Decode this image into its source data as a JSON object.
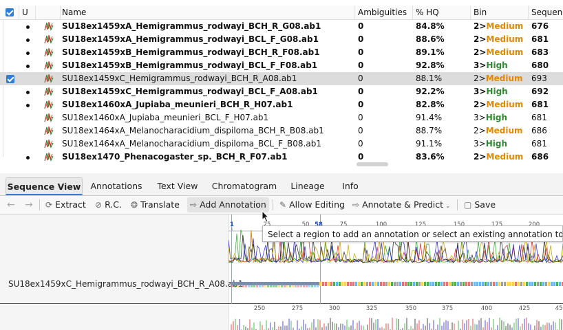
{
  "table": {
    "columns": [
      "",
      "U",
      "",
      "Name",
      "Ambiguities",
      "% HQ",
      "Bin",
      "Sequence"
    ],
    "rows": [
      {
        "name": "SU18ex1459xA_Hemigrammus_rodwayi_BCH_R_G08.ab1",
        "amb": "0",
        "hq": "84.8%",
        "binnum": "2>",
        "binlabel": "Medium",
        "seq": "676",
        "bold": true,
        "checked": false,
        "dot": true
      },
      {
        "name": "SU18ex1459xA_Hemigrammus_rodwayi_BCL_F_G08.ab1",
        "amb": "0",
        "hq": "88.6%",
        "binnum": "2>",
        "binlabel": "Medium",
        "seq": "681",
        "bold": true,
        "checked": false,
        "dot": true
      },
      {
        "name": "SU18ex1459xB_Hemigrammus_rodwayi_BCH_R_F08.ab1",
        "amb": "0",
        "hq": "89.1%",
        "binnum": "2>",
        "binlabel": "Medium",
        "seq": "683",
        "bold": true,
        "checked": false,
        "dot": true
      },
      {
        "name": "SU18ex1459xB_Hemigrammus_rodwayi_BCL_F_F08.ab1",
        "amb": "0",
        "hq": "92.8%",
        "binnum": "3>",
        "binlabel": "High",
        "seq": "680",
        "bold": true,
        "checked": false,
        "dot": true
      },
      {
        "name": "SU18ex1459xC_Hemigrammus_rodwayi_BCH_R_A08.ab1",
        "amb": "0",
        "hq": "88.1%",
        "binnum": "2>",
        "binlabel": "Medium",
        "seq": "693",
        "bold": false,
        "checked": true,
        "dot": false
      },
      {
        "name": "SU18ex1459xC_Hemigrammus_rodwayi_BCL_F_A08.ab1",
        "amb": "0",
        "hq": "92.2%",
        "binnum": "3>",
        "binlabel": "High",
        "seq": "692",
        "bold": true,
        "checked": false,
        "dot": true
      },
      {
        "name": "SU18ex1460xA_Jupiaba_meunieri_BCH_R_H07.ab1",
        "amb": "0",
        "hq": "82.8%",
        "binnum": "2>",
        "binlabel": "Medium",
        "seq": "681",
        "bold": true,
        "checked": false,
        "dot": true
      },
      {
        "name": "SU18ex1460xA_Jupiaba_meunieri_BCL_F_H07.ab1",
        "amb": "0",
        "hq": "91.4%",
        "binnum": "3>",
        "binlabel": "High",
        "seq": "681",
        "bold": false,
        "checked": false,
        "dot": false
      },
      {
        "name": "SU18ex1464xA_Melanocharacidium_dispiloma_BCH_R_B08.ab1",
        "amb": "0",
        "hq": "88.7%",
        "binnum": "2>",
        "binlabel": "Medium",
        "seq": "686",
        "bold": false,
        "checked": false,
        "dot": false
      },
      {
        "name": "SU18ex1464xA_Melanocharacidium_dispiloma_BCL_F_B08.ab1",
        "amb": "0",
        "hq": "91.1%",
        "binnum": "3>",
        "binlabel": "High",
        "seq": "681",
        "bold": false,
        "checked": false,
        "dot": false
      },
      {
        "name": "SU18ex1470_Phenacogaster_sp._BCH_R_F07.ab1",
        "amb": "0",
        "hq": "83.6%",
        "binnum": "2>",
        "binlabel": "Medium",
        "seq": "686",
        "bold": true,
        "checked": false,
        "dot": true
      }
    ]
  },
  "tabs": [
    "Sequence View",
    "Annotations",
    "Text View",
    "Chromatogram",
    "Lineage",
    "Info"
  ],
  "toolbar": {
    "extract": "Extract",
    "rc": "R.C.",
    "translate": "Translate",
    "add_annotation": "Add Annotation",
    "allow_editing": "Allow Editing",
    "annotate_predict": "Annotate & Predict",
    "save": "Save"
  },
  "sequence": {
    "name": "SU18ex1459xC_Hemigrammus_rodwayi_BCH_R_A08.ab1",
    "ruler_top": [
      "1",
      "25",
      "50",
      "58",
      "75",
      "100",
      "125",
      "150",
      "175",
      "200"
    ],
    "ruler_bottom": [
      "250",
      "275",
      "300",
      "325",
      "350",
      "375",
      "400",
      "425",
      "45"
    ]
  },
  "tooltip": "Select a region to add an annotation or select an existing annotation to edit it.",
  "colors": {
    "medium": "#e08a00",
    "high": "#2e8b2e",
    "accent": "#2f7fd8",
    "trim": "#7a8fb0"
  }
}
